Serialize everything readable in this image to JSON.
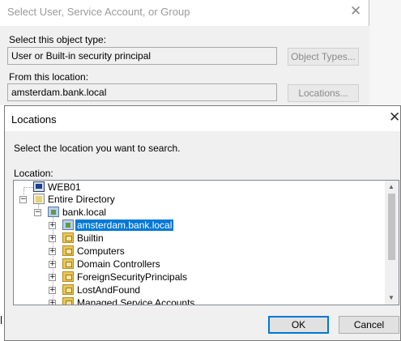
{
  "background_dialog": {
    "title": "Select User, Service Account, or Group",
    "object_type_label": "Select this object type:",
    "object_type_value": "User or Built-in security principal",
    "object_types_button": "Object Types...",
    "location_label": "From this location:",
    "location_value": "amsterdam.bank.local",
    "locations_button": "Locations..."
  },
  "locations_dialog": {
    "title": "Locations",
    "instruction": "Select the location you want to search.",
    "location_label": "Location:",
    "tree": [
      {
        "label": "WEB01",
        "icon": "computer-icon",
        "level": 0,
        "expander": "none",
        "selected": false
      },
      {
        "label": "Entire Directory",
        "icon": "directory-icon",
        "level": 0,
        "expander": "minus",
        "selected": false
      },
      {
        "label": "bank.local",
        "icon": "domain-icon",
        "level": 1,
        "expander": "minus",
        "selected": false
      },
      {
        "label": "amsterdam.bank.local",
        "icon": "domain-icon",
        "level": 2,
        "expander": "plus",
        "selected": true
      },
      {
        "label": "Builtin",
        "icon": "folder-icon",
        "level": 2,
        "expander": "plus",
        "selected": false
      },
      {
        "label": "Computers",
        "icon": "folder-icon",
        "level": 2,
        "expander": "plus",
        "selected": false
      },
      {
        "label": "Domain Controllers",
        "icon": "folder-icon",
        "level": 2,
        "expander": "plus",
        "selected": false
      },
      {
        "label": "ForeignSecurityPrincipals",
        "icon": "folder-icon",
        "level": 2,
        "expander": "plus",
        "selected": false
      },
      {
        "label": "LostAndFound",
        "icon": "folder-icon",
        "level": 2,
        "expander": "plus",
        "selected": false
      },
      {
        "label": "Managed Service Accounts",
        "icon": "folder-icon",
        "level": 2,
        "expander": "plus",
        "selected": false
      }
    ],
    "ok_button": "OK",
    "cancel_button": "Cancel"
  },
  "colors": {
    "selection": "#0078d7",
    "dialog_bg": "#f0f0f0"
  }
}
